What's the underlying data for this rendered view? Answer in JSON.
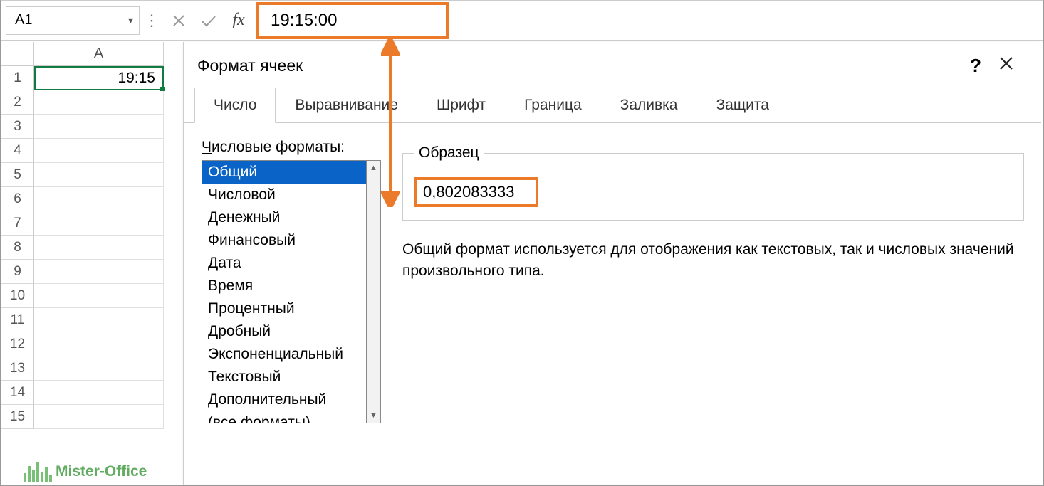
{
  "formula_bar": {
    "cell_ref": "A1",
    "value": "19:15:00"
  },
  "col_header": "A",
  "row_headers": [
    "1",
    "2",
    "3",
    "4",
    "5",
    "6",
    "7",
    "8",
    "9",
    "10",
    "11",
    "12",
    "13",
    "14",
    "15"
  ],
  "cell_A1": "19:15",
  "dialog": {
    "title": "Формат ячеек",
    "tabs": [
      "Число",
      "Выравнивание",
      "Шрифт",
      "Граница",
      "Заливка",
      "Защита"
    ],
    "active_tab": 0,
    "formats_label_pre": "Ч",
    "formats_label_rest": "исловые форматы:",
    "formats": [
      "Общий",
      "Числовой",
      "Денежный",
      "Финансовый",
      "Дата",
      "Время",
      "Процентный",
      "Дробный",
      "Экспоненциальный",
      "Текстовый",
      "Дополнительный",
      "(все форматы)"
    ],
    "selected_format": 0,
    "sample_label": "Образец",
    "sample_value": "0,802083333",
    "description": "Общий формат используется для отображения как текстовых, так и числовых значений произвольного типа."
  },
  "watermark": "Mister-Office"
}
